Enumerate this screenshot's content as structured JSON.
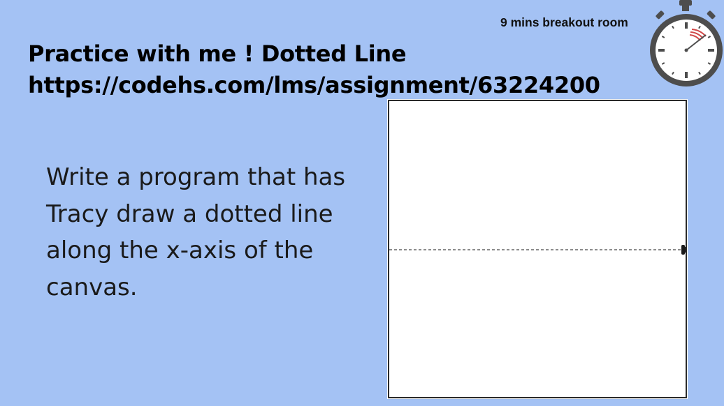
{
  "timer": {
    "label": "9 mins breakout room"
  },
  "title": {
    "line1": "Practice with me ! Dotted Line",
    "line2": "https://codehs.com/lms/assignment/63224200"
  },
  "instructions": {
    "text": "Write a program that has Tracy draw a dotted line along the x-axis of the canvas."
  },
  "canvas": {
    "line_style": "dotted",
    "line_color": "#666666",
    "turtle_icon": "turtle-icon",
    "stopwatch_icon": "stopwatch-icon"
  }
}
